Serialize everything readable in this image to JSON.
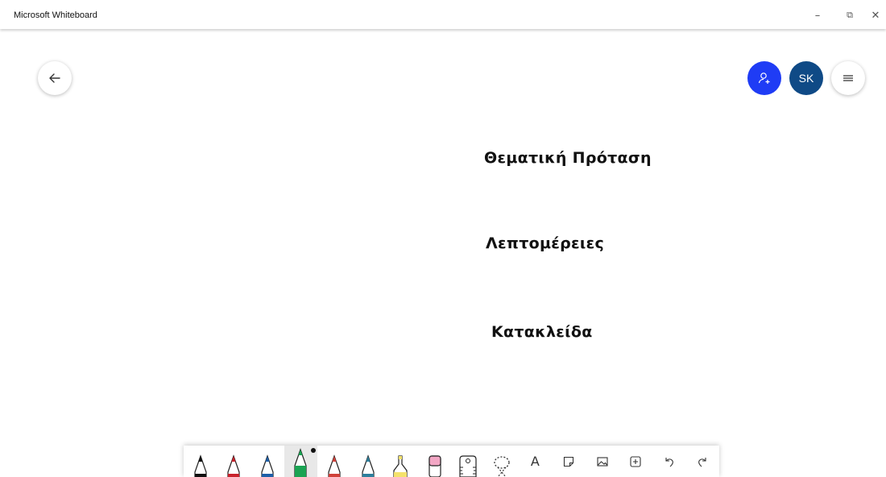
{
  "window": {
    "title": "Microsoft Whiteboard",
    "controls": {
      "minimize": "–",
      "restore": "⧉",
      "close": "✕"
    }
  },
  "header": {
    "back_icon": "arrow-left-icon",
    "invite_icon": "add-person-icon",
    "avatar_initials": "SK",
    "menu_icon": "hamburger-icon",
    "colors": {
      "invite": "#1f3cf5",
      "avatar": "#0f4a86"
    }
  },
  "canvas": {
    "texts": [
      "Θεματική Πρόταση",
      "Λεπτομέρειες",
      "Κατακλείδα"
    ]
  },
  "toolbar": {
    "tools": [
      {
        "name": "pen-black",
        "color": "#111111",
        "selected": false
      },
      {
        "name": "pen-red",
        "color": "#c8232c",
        "selected": false
      },
      {
        "name": "pen-blue",
        "color": "#1e5fa8",
        "selected": false
      },
      {
        "name": "pen-green",
        "color": "#1aa352",
        "selected": true
      },
      {
        "name": "pen-red-2",
        "color": "#d0413a",
        "selected": false
      },
      {
        "name": "pen-teal",
        "color": "#2d7f9c",
        "selected": false
      },
      {
        "name": "highlighter-yellow",
        "color": "#f4e26b",
        "selected": false
      },
      {
        "name": "eraser",
        "color": "#f2a6c4",
        "selected": false
      },
      {
        "name": "ruler",
        "color": "#333333",
        "selected": false
      },
      {
        "name": "lasso",
        "color": "#333333",
        "selected": false
      },
      {
        "name": "text",
        "glyph": "A",
        "selected": false
      },
      {
        "name": "sticky-note",
        "selected": false
      },
      {
        "name": "image",
        "selected": false
      },
      {
        "name": "insert",
        "selected": false
      },
      {
        "name": "undo",
        "selected": false
      },
      {
        "name": "redo",
        "selected": false
      }
    ]
  }
}
